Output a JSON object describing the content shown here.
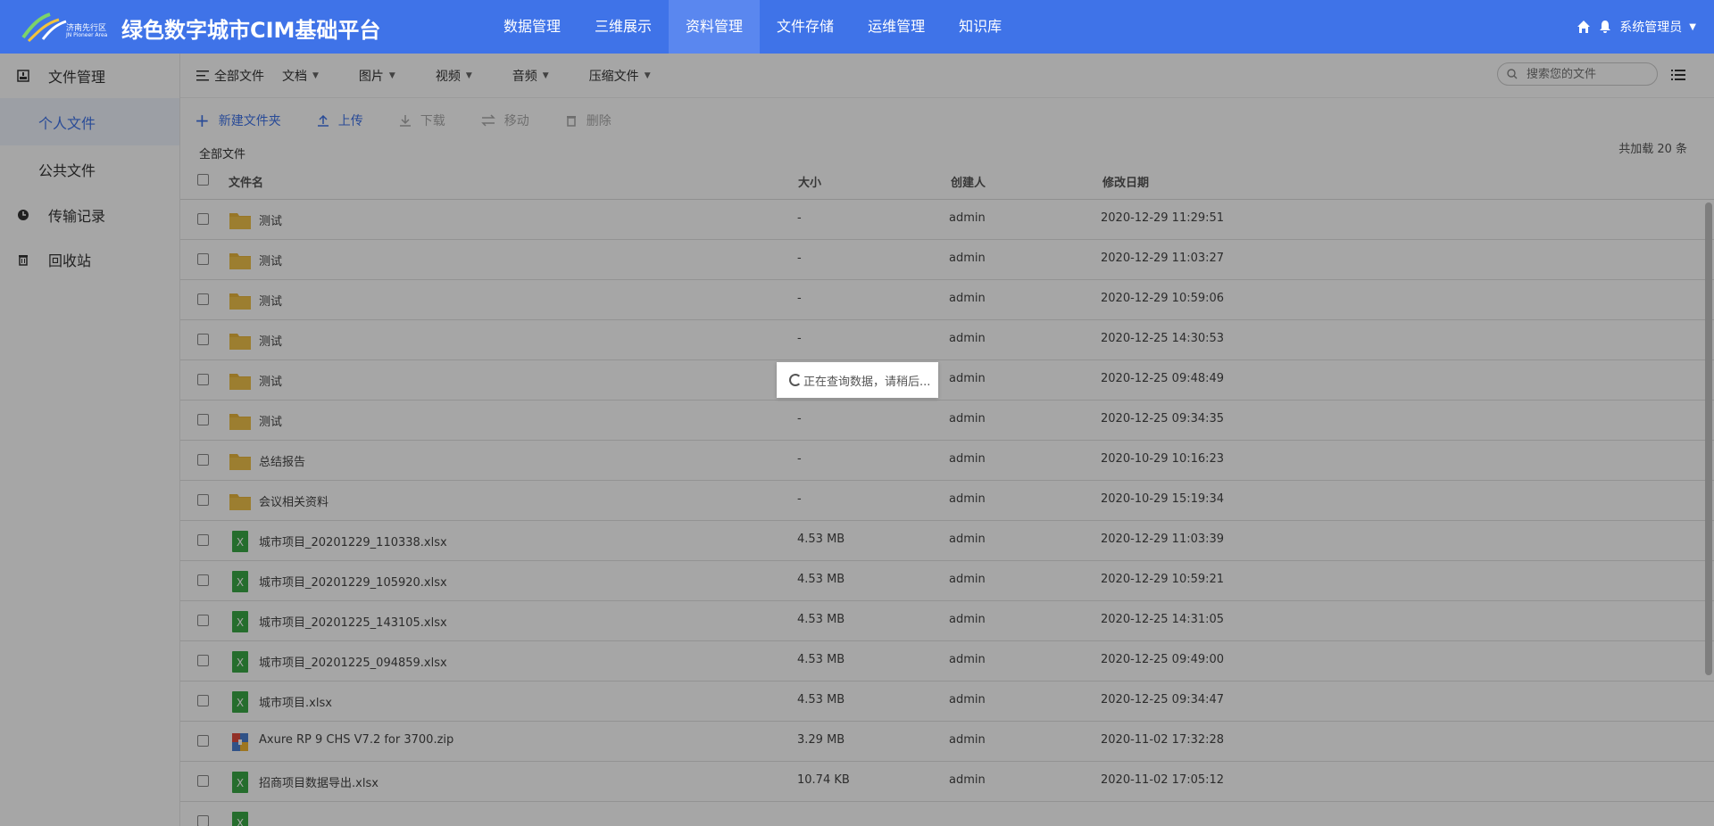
{
  "app": {
    "title": "绿色数字城市CIM基础平台",
    "logo_text": "济南先行区",
    "logo_sub": "JN Pioneer Area"
  },
  "nav": [
    {
      "label": "数据管理"
    },
    {
      "label": "三维展示"
    },
    {
      "label": "资料管理",
      "active": true
    },
    {
      "label": "文件存储"
    },
    {
      "label": "运维管理"
    },
    {
      "label": "知识库"
    }
  ],
  "user": {
    "name": "系统管理员"
  },
  "sidebar": {
    "file_manage": "文件管理",
    "personal": "个人文件",
    "public": "公共文件",
    "transfer": "传输记录",
    "recycle": "回收站"
  },
  "filters": {
    "all": "全部文件",
    "doc": "文档",
    "image": "图片",
    "video": "视频",
    "audio": "音频",
    "zip": "压缩文件"
  },
  "search": {
    "placeholder": "搜索您的文件"
  },
  "toolbar": {
    "new_folder": "新建文件夹",
    "upload": "上传",
    "download": "下载",
    "move": "移动",
    "delete": "删除"
  },
  "breadcrumb": "全部文件",
  "loaded_count": "共加载 20 条",
  "columns": {
    "name": "文件名",
    "size": "大小",
    "creator": "创建人",
    "modified": "修改日期"
  },
  "files": [
    {
      "type": "folder",
      "name": "测试",
      "size": "-",
      "creator": "admin",
      "date": "2020-12-29 11:29:51"
    },
    {
      "type": "folder",
      "name": "测试",
      "size": "-",
      "creator": "admin",
      "date": "2020-12-29 11:03:27"
    },
    {
      "type": "folder",
      "name": "测试",
      "size": "-",
      "creator": "admin",
      "date": "2020-12-29 10:59:06"
    },
    {
      "type": "folder",
      "name": "测试",
      "size": "-",
      "creator": "admin",
      "date": "2020-12-25 14:30:53"
    },
    {
      "type": "folder",
      "name": "测试",
      "size": "-",
      "creator": "admin",
      "date": "2020-12-25 09:48:49"
    },
    {
      "type": "folder",
      "name": "测试",
      "size": "-",
      "creator": "admin",
      "date": "2020-12-25 09:34:35"
    },
    {
      "type": "folder",
      "name": "总结报告",
      "size": "-",
      "creator": "admin",
      "date": "2020-10-29 10:16:23"
    },
    {
      "type": "folder",
      "name": "会议相关资料",
      "size": "-",
      "creator": "admin",
      "date": "2020-10-29 15:19:34"
    },
    {
      "type": "excel",
      "name": "城市项目_20201229_110338.xlsx",
      "size": "4.53 MB",
      "creator": "admin",
      "date": "2020-12-29 11:03:39"
    },
    {
      "type": "excel",
      "name": "城市项目_20201229_105920.xlsx",
      "size": "4.53 MB",
      "creator": "admin",
      "date": "2020-12-29 10:59:21"
    },
    {
      "type": "excel",
      "name": "城市项目_20201225_143105.xlsx",
      "size": "4.53 MB",
      "creator": "admin",
      "date": "2020-12-25 14:31:05"
    },
    {
      "type": "excel",
      "name": "城市项目_20201225_094859.xlsx",
      "size": "4.53 MB",
      "creator": "admin",
      "date": "2020-12-25 09:49:00"
    },
    {
      "type": "excel",
      "name": "城市项目.xlsx",
      "size": "4.53 MB",
      "creator": "admin",
      "date": "2020-12-25 09:34:47"
    },
    {
      "type": "zip",
      "name": "Axure RP 9 CHS V7.2 for 3700.zip",
      "size": "3.29 MB",
      "creator": "admin",
      "date": "2020-11-02 17:32:28"
    },
    {
      "type": "excel",
      "name": "招商项目数据导出.xlsx",
      "size": "10.74 KB",
      "creator": "admin",
      "date": "2020-11-02 17:05:12"
    },
    {
      "type": "excel",
      "name": "",
      "size": "",
      "creator": "",
      "date": ""
    }
  ],
  "loading": {
    "text": "正在查询数据，请稍后..."
  },
  "colors": {
    "header": "#3f73e8",
    "accent": "#3f73e8",
    "folder": "#e8b63c",
    "excel": "#3aa845"
  }
}
